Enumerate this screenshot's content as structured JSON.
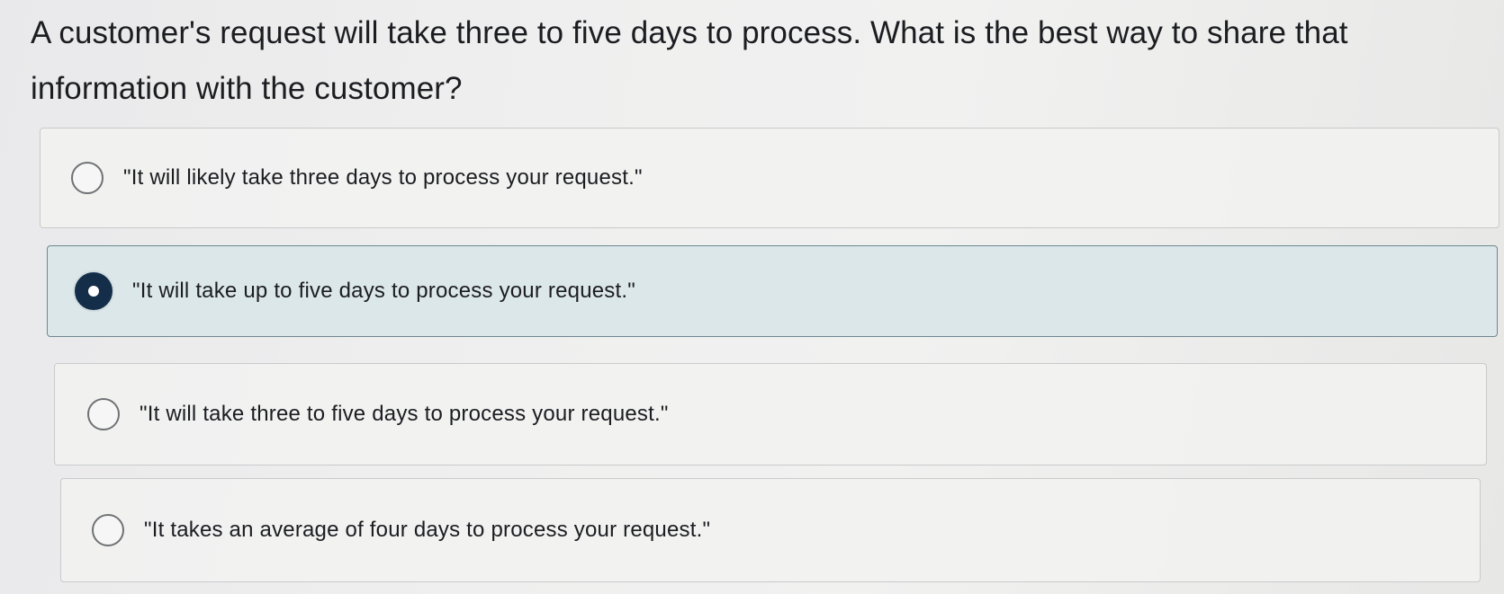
{
  "question": {
    "text": "A customer's request will take three to five days to process. What is the best way to share that information with the customer?"
  },
  "options": [
    {
      "label": "\"It will likely take three days to process your request.\"",
      "selected": false
    },
    {
      "label": "\"It will take up to five days to process your request.\"",
      "selected": true
    },
    {
      "label": "\"It will take three to five days to process your request.\"",
      "selected": false
    },
    {
      "label": "\"It takes an average of four days to process your request.\"",
      "selected": false
    }
  ],
  "colors": {
    "selected_fill": "#dce7ea",
    "radio_selected": "#142d49"
  }
}
